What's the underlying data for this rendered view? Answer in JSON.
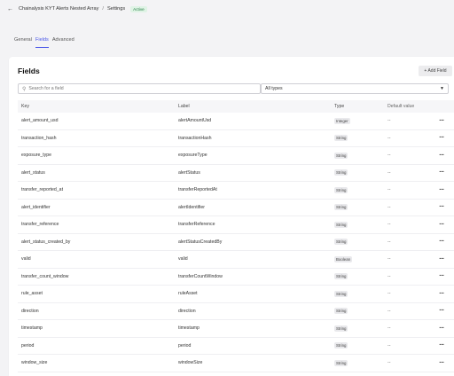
{
  "header": {
    "title": "Chainalysis KYT Alerts Nested Array",
    "separator": "/",
    "section": "Settings",
    "status": "Active"
  },
  "tabs": [
    {
      "label": "General",
      "active": false
    },
    {
      "label": "Fields",
      "active": true
    },
    {
      "label": "Advanced",
      "active": false
    }
  ],
  "card": {
    "title": "Fields",
    "add_label": "+ Add Field",
    "search_placeholder": "Search for a field",
    "type_filter": "All types"
  },
  "columns": {
    "key": "Key",
    "label": "Label",
    "type": "Type",
    "default": "Default value"
  },
  "rows": [
    {
      "key": "alert_amount_usd",
      "label": "alertAmountUsd",
      "type": "Integer",
      "default": "--"
    },
    {
      "key": "transaction_hash",
      "label": "transactionHash",
      "type": "String",
      "default": "--"
    },
    {
      "key": "exposure_type",
      "label": "exposureType",
      "type": "String",
      "default": "--"
    },
    {
      "key": "alert_status",
      "label": "alertStatus",
      "type": "String",
      "default": "--"
    },
    {
      "key": "transfer_reported_at",
      "label": "transferReportedAt",
      "type": "String",
      "default": "--"
    },
    {
      "key": "alert_identifier",
      "label": "alertIdentifier",
      "type": "String",
      "default": "--"
    },
    {
      "key": "transfer_reference",
      "label": "transferReference",
      "type": "String",
      "default": "--"
    },
    {
      "key": "alert_status_created_by",
      "label": "alertStatusCreatedBy",
      "type": "String",
      "default": "--"
    },
    {
      "key": "valid",
      "label": "valid",
      "type": "Boolean",
      "default": "--"
    },
    {
      "key": "transfer_count_window",
      "label": "transferCountWindow",
      "type": "String",
      "default": "--"
    },
    {
      "key": "rule_asset",
      "label": "ruleAsset",
      "type": "String",
      "default": "--"
    },
    {
      "key": "direction",
      "label": "direction",
      "type": "String",
      "default": "--"
    },
    {
      "key": "timestamp",
      "label": "timestamp",
      "type": "String",
      "default": "--"
    },
    {
      "key": "period",
      "label": "period",
      "type": "String",
      "default": "--"
    },
    {
      "key": "window_size",
      "label": "windowSize",
      "type": "String",
      "default": "--"
    }
  ],
  "icons": {
    "back": "arrow-left-icon",
    "search": "search-icon",
    "chevron": "chevron-down-icon",
    "menu": "more-horizontal-icon"
  },
  "colors": {
    "accent": "#4a57e8",
    "active_badge_bg": "#dff3e5",
    "active_badge_text": "#1e7a3f"
  }
}
